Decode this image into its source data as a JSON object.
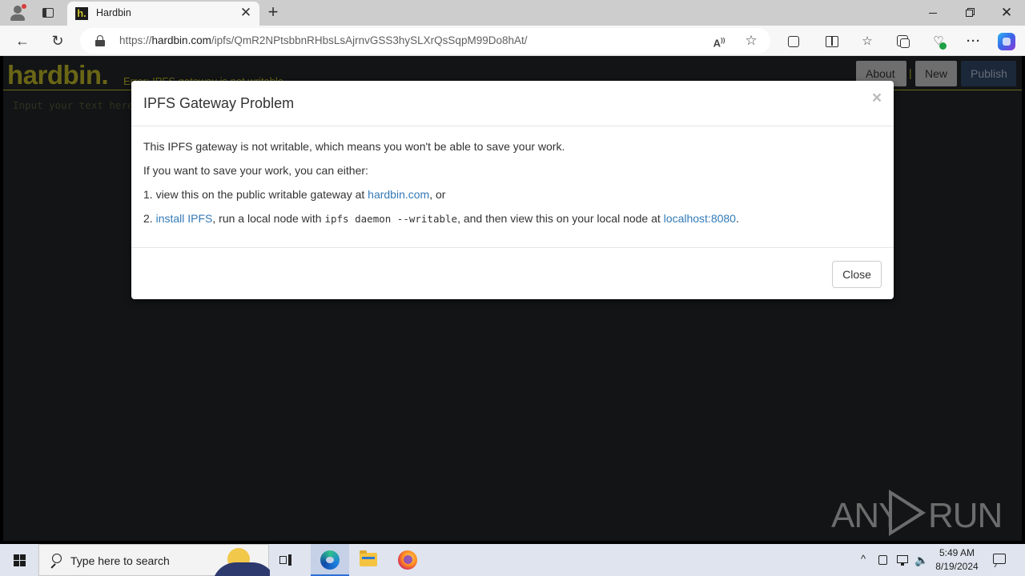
{
  "browser": {
    "tab": {
      "title": "Hardbin",
      "favicon_letter": "h."
    },
    "address": {
      "url_prefix": "https://",
      "url_host": "hardbin.com",
      "url_path": "/ipfs/QmR2NPtsbbnRHbsLsAjrnvGSS3hySLXrQsSqpM99Do8hAt/"
    },
    "icons": {
      "read_aloud": "read-aloud-icon",
      "favorite": "star-icon",
      "extensions": "extensions-icon",
      "split_screen": "split-screen-icon",
      "favorites": "favorites-icon",
      "collections": "collections-icon",
      "performance": "browser-essentials-icon",
      "more": "more-icon",
      "copilot": "copilot-icon"
    }
  },
  "hardbin": {
    "logo": "hardbin.",
    "error_text": "Error: IPFS gateway is not writable",
    "nav": {
      "about": "About",
      "separator": "|",
      "new": "New",
      "publish": "Publish"
    },
    "editor_placeholder": "Input your text here",
    "colors": {
      "accent": "#c2ba28",
      "background": "#222528",
      "publish": "#324a6b"
    }
  },
  "modal": {
    "title": "IPFS Gateway Problem",
    "close_x": "×",
    "line1": "This IPFS gateway is not writable, which means you won't be able to save your work.",
    "line2": "If you want to save your work, you can either:",
    "line3": {
      "prefix": "1. view this on the public writable gateway at ",
      "link": "hardbin.com",
      "suffix": ", or"
    },
    "line4": {
      "prefix": "2. ",
      "link1": "install IPFS",
      "mid1": ", run a local node with ",
      "code": "ipfs daemon --writable",
      "mid2": ", and then view this on your local node at ",
      "link2": "localhost:8080",
      "suffix": "."
    },
    "close_button": "Close",
    "link_color": "#337ab7"
  },
  "watermark": {
    "left": "ANY",
    "right": "RUN"
  },
  "taskbar": {
    "search_placeholder": "Type here to search",
    "time": "5:49 AM",
    "date": "8/19/2024",
    "tray_chevron": "^"
  }
}
